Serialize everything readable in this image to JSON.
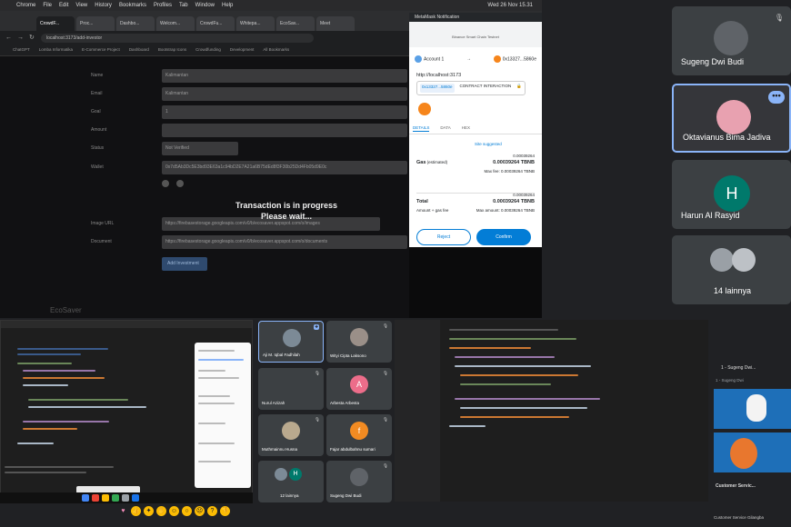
{
  "browser": {
    "menubar": [
      "Chrome",
      "File",
      "Edit",
      "View",
      "History",
      "Bookmarks",
      "Profiles",
      "Tab",
      "Window",
      "Help"
    ],
    "clock": "Wed 26 Nov 15.31",
    "tabs": [
      "CrowdF...",
      "Proc...",
      "Dashbo...",
      "Welcom...",
      "CrowdFu...",
      "Whitepa...",
      "EcoSav...",
      "Meet"
    ],
    "url": "localhost:3173/add-investor",
    "bookmarks": [
      "ChatGPT",
      "Lomba Informatika",
      "E-Commerce Project",
      "Dashboard",
      "Bootstrap Icons",
      "Crowdfunding",
      "Development",
      "All Bookmarks"
    ]
  },
  "form": {
    "fields": [
      {
        "label": "Name",
        "value": "Kalimantan"
      },
      {
        "label": "Email",
        "value": "Kalimantan"
      },
      {
        "label": "Goal",
        "value": "1"
      },
      {
        "label": "Amount",
        "value": ""
      },
      {
        "label": "Status",
        "value": "Not Verified"
      },
      {
        "label": "Wallet",
        "value": "0x7d5Ab3Dc5E3bd93E63a1c94bD2E7A21a6B75dEd8f3F30b25Dd4Fb05d9E0c"
      },
      {
        "label": "Image URL",
        "value": "https://firebasestorage.googleapis.com/v0/b/ecosaver.appspot.com/o/images"
      },
      {
        "label": "Document",
        "value": "https://firebasestorage.googleapis.com/v0/b/ecosaver.appspot.com/o/documents"
      }
    ],
    "overlay_line1": "Transaction is in progress",
    "overlay_line2": "Please wait...",
    "submit_label": "Add Investment",
    "brand": "EcoSaver"
  },
  "metamask": {
    "window_title": "MetaMask Notification",
    "network": "Binance Smart Chain Testnet",
    "account": "Account 1",
    "target": "0x13327...5860e",
    "origin": "http://localhost:3173",
    "contract_addr": "0x13327...5860e",
    "contract_label": "CONTRACT INTERACTION",
    "tabs": [
      "DETAILS",
      "DATA",
      "HEX"
    ],
    "suggest": "Site suggested",
    "gas_label": "Gas",
    "gas_sub": "(estimated)",
    "gas_small": "0.00039264",
    "gas_value": "0.00039264 TBNB",
    "max_fee": "Max fee: 0.00039264 TBNB",
    "total_label": "Total",
    "total_sub": "Amount + gas fee",
    "total_small": "0.00039264",
    "total_value": "0.00039264 TBNB",
    "max_amount": "Max amount: 0.00039264 TBNB",
    "reject": "Reject",
    "confirm": "Confirm"
  },
  "participants": {
    "sugeng": "Sugeng Dwi Budi",
    "oktavianus": "Oktavianus Bima Jadiva",
    "harun": "Harun Al Rasyid",
    "harun_initial": "H",
    "others": "14 lainnya",
    "more": "•••"
  },
  "grid": [
    {
      "name": "Aji M. Iqbal Fadhilah",
      "initial": ""
    },
    {
      "name": "Wityi Cipta Laksono",
      "initial": ""
    },
    {
      "name": "Nurul Azizah",
      "initial": ""
    },
    {
      "name": "Arbesta Arbesta",
      "initial": "A"
    },
    {
      "name": "Muthmainnu Husna",
      "initial": ""
    },
    {
      "name": "Fajar abdulbahnu sumari",
      "initial": "f"
    },
    {
      "name": "12 lainnya",
      "initial": "H"
    },
    {
      "name": "Sugeng Dwi Budi",
      "initial": ""
    }
  ],
  "right_panel": {
    "title": "1 - Sugeng Dwi...",
    "sub": "1 - Sugeng Dwi",
    "cs_label": "Customer Servic...",
    "footer": "Customer Service Gilangba"
  },
  "colors": {
    "meet_bg": "#202124",
    "tile_bg": "#3c4043",
    "metamask_blue": "#037dd6",
    "harun_avatar": "#00796b",
    "arbesta_avatar": "#ec6d8a",
    "fajar_avatar": "#f28b22"
  }
}
